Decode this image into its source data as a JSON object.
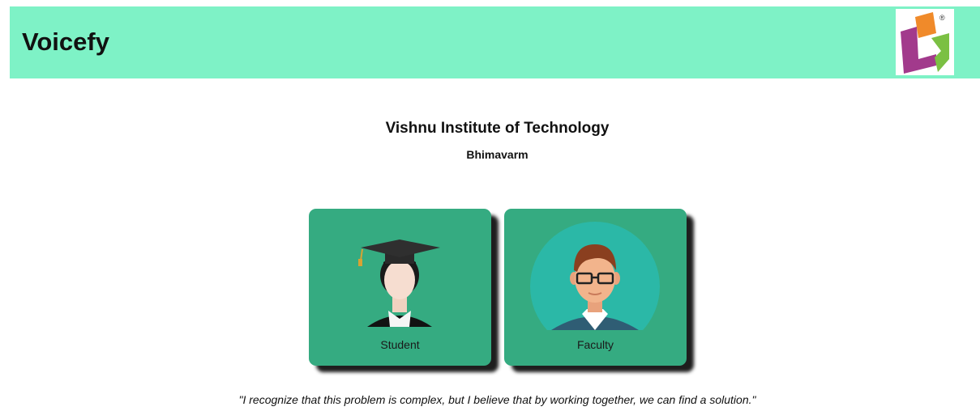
{
  "header": {
    "app_title": "Voicefy",
    "logo_icon": "voicefy-logo-icon",
    "background_color": "#7ef2c6"
  },
  "institution": {
    "name": "Vishnu Institute of Technology",
    "city": "Bhimavarm"
  },
  "roles": [
    {
      "label": "Student",
      "icon": "student-graduate-icon"
    },
    {
      "label": "Faculty",
      "icon": "faculty-person-icon"
    }
  ],
  "card_color": "#35ab81",
  "quote": "\"I recognize that this problem is complex, but I believe that by working together, we can find a solution.\""
}
